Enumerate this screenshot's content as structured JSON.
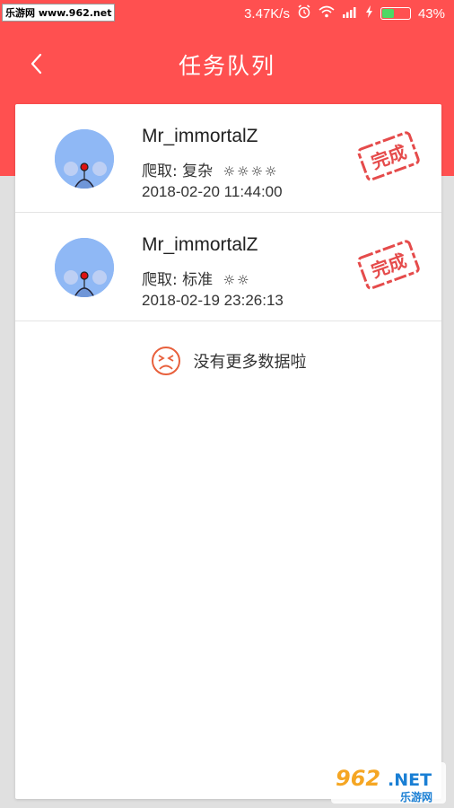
{
  "status_bar": {
    "watermark": "乐游网 www.962.net",
    "speed": "3.47K/s",
    "battery_percent": "43%",
    "battery_level": 0.43
  },
  "header": {
    "title": "任务队列",
    "back_icon": "chevron-left-icon"
  },
  "tasks": [
    {
      "user": "Mr_immortalZ",
      "crawl_label": "爬取: 复杂",
      "stars": "☼☼☼☼",
      "time": "2018-02-20 11:44:00",
      "status": "完成"
    },
    {
      "user": "Mr_immortalZ",
      "crawl_label": "爬取: 标准",
      "stars": "☼☼",
      "time": "2018-02-19 23:26:13",
      "status": "完成"
    }
  ],
  "empty_message": "没有更多数据啦",
  "footer_watermark": {
    "main": "962",
    "net": ".NET",
    "sub": "乐游网"
  },
  "colors": {
    "accent": "#ff5050",
    "stamp": "#e54b4b"
  }
}
